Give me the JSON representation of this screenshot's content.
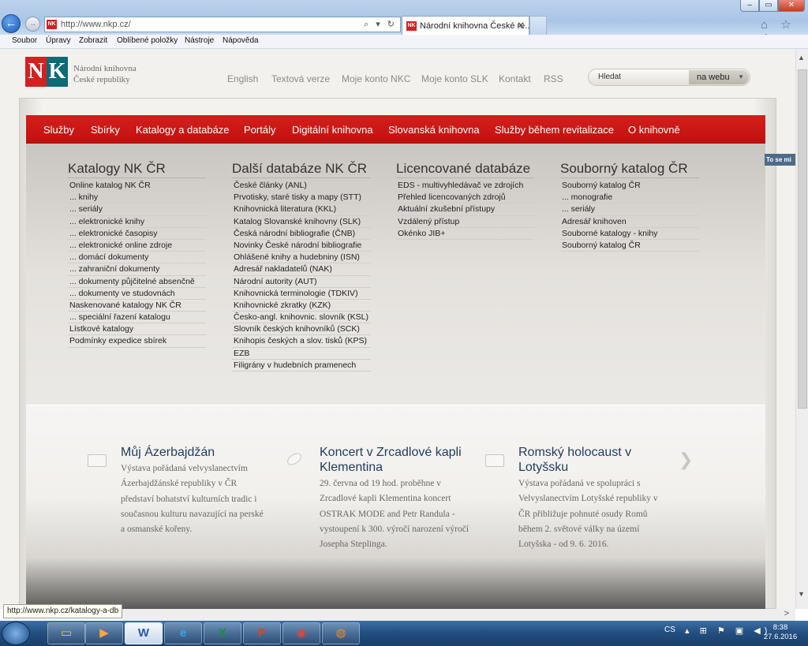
{
  "browser": {
    "window_controls": {
      "minimize": "–",
      "maximize": "▭",
      "close": "✕"
    },
    "back_icon": "←",
    "forward_icon": "→",
    "address": "http://www.nkp.cz/",
    "address_tools": "⌕ ▾ ↻",
    "tab_title": "Národní knihovna České re...",
    "tab_close": "✕",
    "favicon_text": "NK",
    "top_icons": "⌂ ☆ ⚙",
    "menu": [
      "Soubor",
      "Úpravy",
      "Zobrazit",
      "Oblíbené položky",
      "Nástroje",
      "Nápověda"
    ],
    "status_url": "http://www.nkp.cz/katalogy-a-db",
    "scroll_up": "▲",
    "scroll_down": "▼",
    "scroll_right": ">"
  },
  "site": {
    "logo_n": "N",
    "logo_k": "K",
    "logo_line1": "Národní knihovna",
    "logo_line2": "České republiky",
    "top_links": [
      "English",
      "Textová verze",
      "Moje konto NKC",
      "Moje konto SLK",
      "Kontakt",
      "RSS"
    ],
    "search_placeholder": "Hledat",
    "search_scope": "na webu",
    "search_scope_arrow": "▼",
    "side_tab": "To se mi",
    "nav": [
      "Služby",
      "Sbírky",
      "Katalogy a databáze",
      "Portály",
      "Digitální knihovna",
      "Slovanská knihovna",
      "Služby během revitalizace",
      "O knihovně"
    ],
    "columns": [
      {
        "title": "Katalogy NK ČR",
        "items": [
          "Online katalog NK ČR",
          "... knihy",
          "... seriály",
          "... elektronické knihy",
          "... elektronické časopisy",
          "... elektronické online zdroje",
          "... domácí dokumenty",
          "... zahraniční dokumenty",
          "... dokumenty půjčitelné absenčně",
          "... dokumenty ve studovnách",
          "Naskenované katalogy NK ČR",
          "... speciální řazení katalogu",
          "Lístkové katalogy",
          "Podmínky expedice sbírek"
        ]
      },
      {
        "title": "Další databáze NK ČR",
        "items": [
          "České články (ANL)",
          "Prvotisky, staré tisky a mapy (STT)",
          "Knihovnická literatura (KKL)",
          "Katalog Slovanské knihovny (SLK)",
          "Česká národní bibliografie (ČNB)",
          "Novinky České národní bibliografie",
          "Ohlášené knihy a hudebniny (ISN)",
          "Adresář nakladatelů (NAK)",
          "Národní autority (AUT)",
          "Knihovnická terminologie (TDKIV)",
          "Knihovnické zkratky (KZK)",
          "Česko-angl. knihovnic. slovník (KSL)",
          "Slovník českých knihovníků (SCK)",
          "Knihopis českých a slov. tisků (KPS)",
          "EZB",
          "Filigrány v hudebních pramenech"
        ]
      },
      {
        "title": "Licencované databáze",
        "items": [
          "EDS - multivyhledávač ve zdrojích",
          "Přehled licencovaných zdrojů",
          "Aktuální zkušební přístupy",
          "Vzdálený přístup",
          "Okénko JIB+"
        ]
      },
      {
        "title": "Souborný katalog ČR",
        "items": [
          "Souborný katalog ČR",
          "... monografie",
          "... seriály",
          "Adresář knihoven",
          "Souborné katalogy - knihy",
          "Souborný katalog ČR"
        ]
      }
    ],
    "news": [
      {
        "title": "Můj Ázerbajdžán",
        "text": "Výstava pořádaná velvyslanectvím Ázerbajdžánské republiky v ČR představí bohatství kulturních tradic i současnou kulturu navazující na perské a osmanské kořeny."
      },
      {
        "title": "Koncert v Zrcadlové kapli Klementina",
        "text": "29. června od 19 hod. proběhne v Zrcadlové kapli Klementina koncert OSTRAK MODE and Petr Randula - vystoupení k 300. výročí narození výročí Josepha Steplinga."
      },
      {
        "title": "Romský holocaust v Lotyšsku",
        "text": "Výstava pořádaná ve spolupráci s Velvyslanectvím Lotyšské republiky v ČR přibližuje pohnuté osudy Romů během 2. světové války na území Lotyšska - od 9. 6. 2016."
      }
    ],
    "news_arrow": "❯"
  },
  "taskbar": {
    "apps": [
      "explorer-icon",
      "media-player-icon",
      "word-icon",
      "internet-explorer-icon",
      "excel-icon",
      "powerpoint-icon",
      "chrome-icon",
      "firefox-icon"
    ],
    "app_glyphs": [
      "▭",
      "▶",
      "W",
      "e",
      "X",
      "P",
      "◉",
      "◍"
    ],
    "language": "CS",
    "tray_icons": "▴ ⊞ ⚑ ▣ ◀)",
    "time": "8:38",
    "date": "27.6.2016"
  }
}
